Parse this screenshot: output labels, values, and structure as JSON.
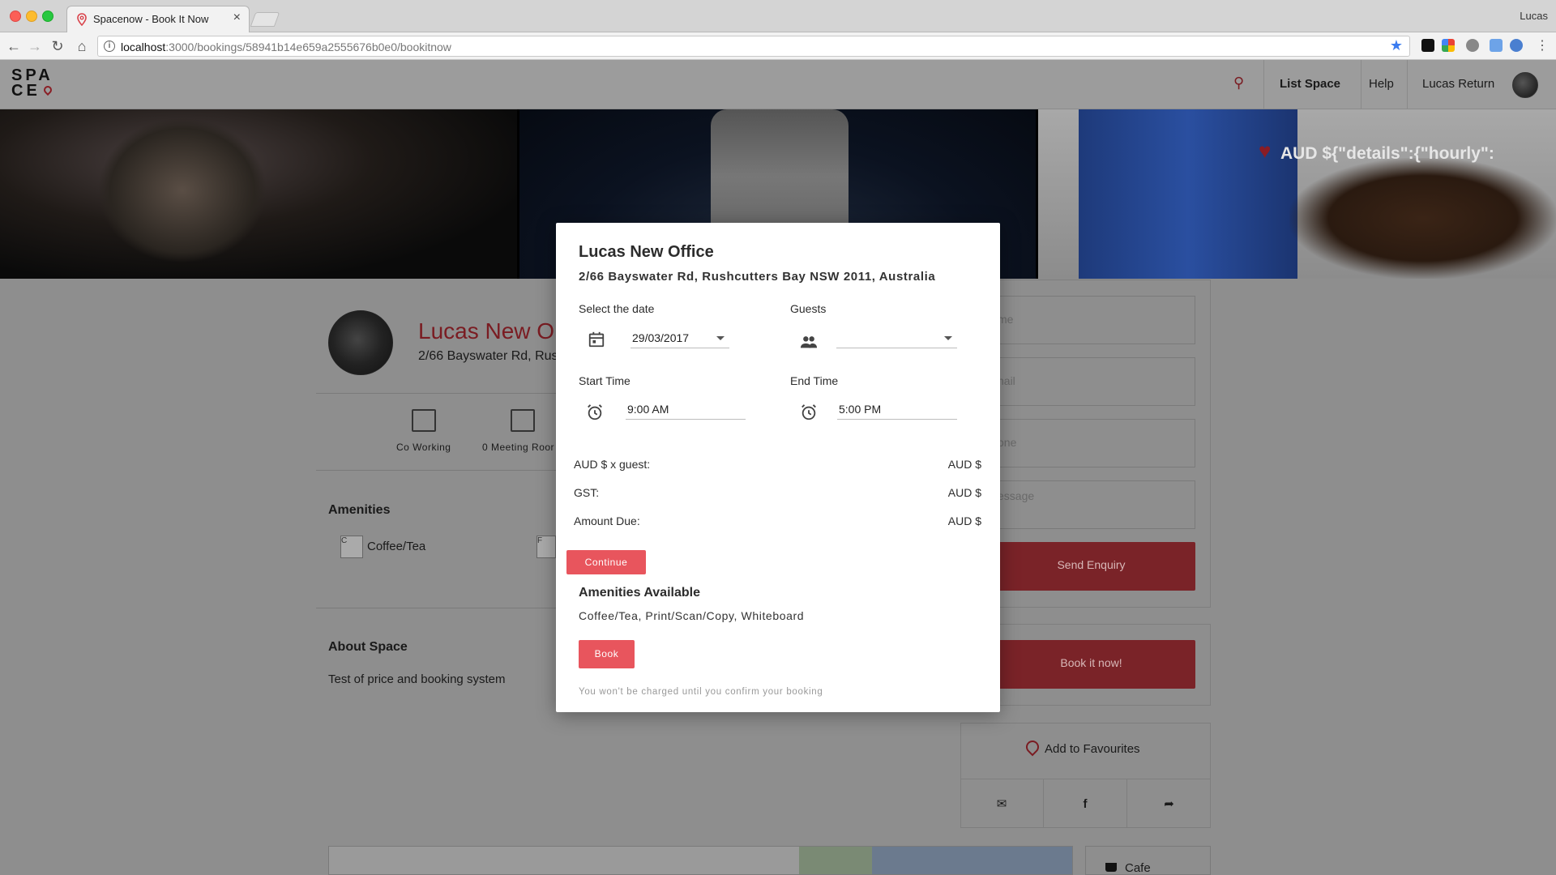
{
  "browser": {
    "tab_title": "Spacenow - Book It Now",
    "tab_close": "×",
    "user_name": "Lucas",
    "url_host": "localhost",
    "url_path": ":3000/bookings/58941b14e659a2555676b0e0/bookitnow"
  },
  "header": {
    "logo_line1": "SPA",
    "logo_line2": "CE",
    "list_space": "List Space",
    "help": "Help",
    "user": "Lucas Return"
  },
  "hero": {
    "price_text": "AUD ${\"details\":{\"hourly\":"
  },
  "listing": {
    "title": "Lucas New O",
    "address": "2/66 Bayswater Rd, Rus",
    "types": [
      {
        "label": "Co Working",
        "icon": "clipboard-icon"
      },
      {
        "label": "0 Meeting Roor",
        "icon": "meeting-room-icon"
      }
    ],
    "amenities_heading": "Amenities",
    "amenities": [
      {
        "img_alt": "C",
        "label": "Coffee/Tea"
      },
      {
        "img_alt": "F",
        "label": ""
      }
    ],
    "about_heading": "About Space",
    "about_text": "Test of price and booking system"
  },
  "enquiry": {
    "name_placeholder": "me",
    "email_placeholder": "nail",
    "phone_placeholder": "one",
    "message_placeholder": "essage",
    "send_label": "Send Enquiry",
    "book_now_label": "Book it now!",
    "favourites_label": "Add to Favourites"
  },
  "cafe": {
    "label": "Cafe"
  },
  "modal": {
    "title": "Lucas New Office",
    "address": "2/66 Bayswater Rd, Rushcutters Bay NSW 2011, Australia",
    "date_label": "Select the date",
    "date_value": "29/03/2017",
    "guests_label": "Guests",
    "guests_value": "",
    "start_label": "Start Time",
    "start_value": "9:00 AM",
    "end_label": "End Time",
    "end_value": "5:00 PM",
    "rows": [
      {
        "label": "AUD $ x guest:",
        "value": "AUD $"
      },
      {
        "label": "GST:",
        "value": "AUD $"
      },
      {
        "label": "Amount Due:",
        "value": "AUD $"
      }
    ],
    "continue_label": "Continue",
    "amenities_heading": "Amenities Available",
    "amenities_list": "Coffee/Tea, Print/Scan/Copy, Whiteboard",
    "book_label": "Book",
    "note": "You won't be charged until you confirm your booking"
  },
  "colors": {
    "accent": "#e8555d",
    "brand_dark_red": "#7a1c22"
  }
}
